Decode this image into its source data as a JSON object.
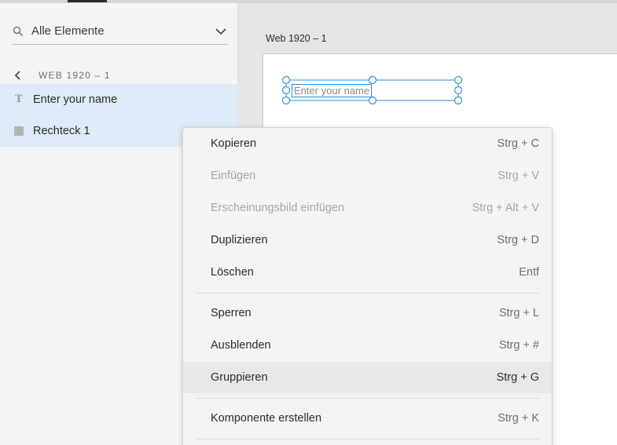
{
  "filter": {
    "value": "Alle Elemente",
    "search_icon": "search-icon",
    "dropdown_icon": "chevron-down-icon"
  },
  "breadcrumb": {
    "label": "WEB 1920 – 1",
    "back_icon": "chevron-left-icon"
  },
  "layers": [
    {
      "label": "Enter your name",
      "icon": "text-icon"
    },
    {
      "label": "Rechteck 1",
      "icon": "rectangle-icon"
    }
  ],
  "artboard": {
    "title": "Web 1920 – 1",
    "textbox_value": "Enter your name"
  },
  "context_menu": {
    "items": [
      {
        "label": "Kopieren",
        "shortcut": "Strg + C",
        "enabled": true
      },
      {
        "label": "Einfügen",
        "shortcut": "Strg + V",
        "enabled": false
      },
      {
        "label": "Erscheinungsbild einfügen",
        "shortcut": "Strg + Alt + V",
        "enabled": false
      },
      {
        "label": "Duplizieren",
        "shortcut": "Strg + D",
        "enabled": true
      },
      {
        "label": "Löschen",
        "shortcut": "Entf",
        "enabled": true
      },
      {
        "label": "Sperren",
        "shortcut": "Strg + L",
        "enabled": true
      },
      {
        "label": "Ausblenden",
        "shortcut": "Strg + #",
        "enabled": true
      },
      {
        "label": "Gruppieren",
        "shortcut": "Strg + G",
        "enabled": true,
        "highlighted": true
      },
      {
        "label": "Komponente erstellen",
        "shortcut": "Strg + K",
        "enabled": true
      }
    ]
  },
  "colors": {
    "selection": "#2d8fd5",
    "layer_highlight": "#dcebf7",
    "panel": "#f5f5f5",
    "canvas": "#e5e5e5"
  }
}
